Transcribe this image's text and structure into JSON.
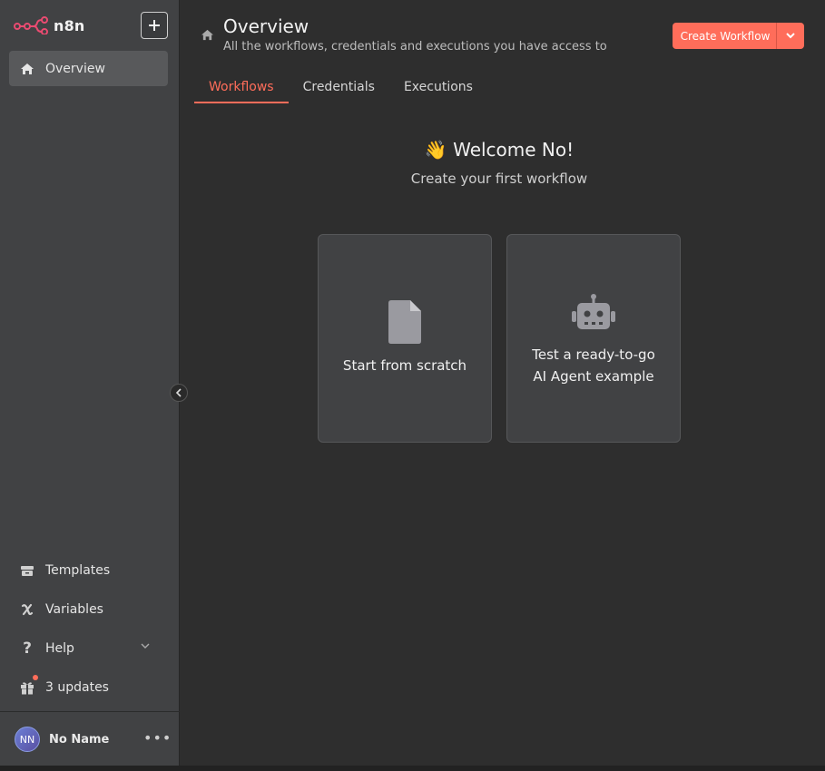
{
  "app": {
    "logo_text": "n8n"
  },
  "sidebar": {
    "active_item": {
      "label": "Overview",
      "icon": "home-icon"
    },
    "bottom_items": [
      {
        "label": "Templates",
        "icon": "box-icon"
      },
      {
        "label": "Variables",
        "icon": "variable-icon"
      },
      {
        "label": "Help",
        "icon": "question-icon"
      },
      {
        "label": "3 updates",
        "icon": "gift-icon"
      }
    ],
    "user": {
      "initials": "NN",
      "name": "No Name"
    },
    "more_label": "•••"
  },
  "header": {
    "title": "Overview",
    "subtitle": "All the workflows, credentials and executions you have access to",
    "create_button": "Create Workflow"
  },
  "tabs": [
    {
      "label": "Workflows",
      "active": true
    },
    {
      "label": "Credentials",
      "active": false
    },
    {
      "label": "Executions",
      "active": false
    }
  ],
  "welcome": {
    "emoji": "👋",
    "title": "Welcome No!",
    "subtitle": "Create your first workflow"
  },
  "cards": [
    {
      "line1": "Start from scratch",
      "icon": "file-icon"
    },
    {
      "line1": "Test a ready-to-go",
      "line2": "AI Agent example",
      "icon": "robot-icon"
    }
  ],
  "colors": {
    "accent": "#ff6d5a",
    "sidebar_bg": "#414244",
    "main_bg": "#2e2e2e"
  }
}
